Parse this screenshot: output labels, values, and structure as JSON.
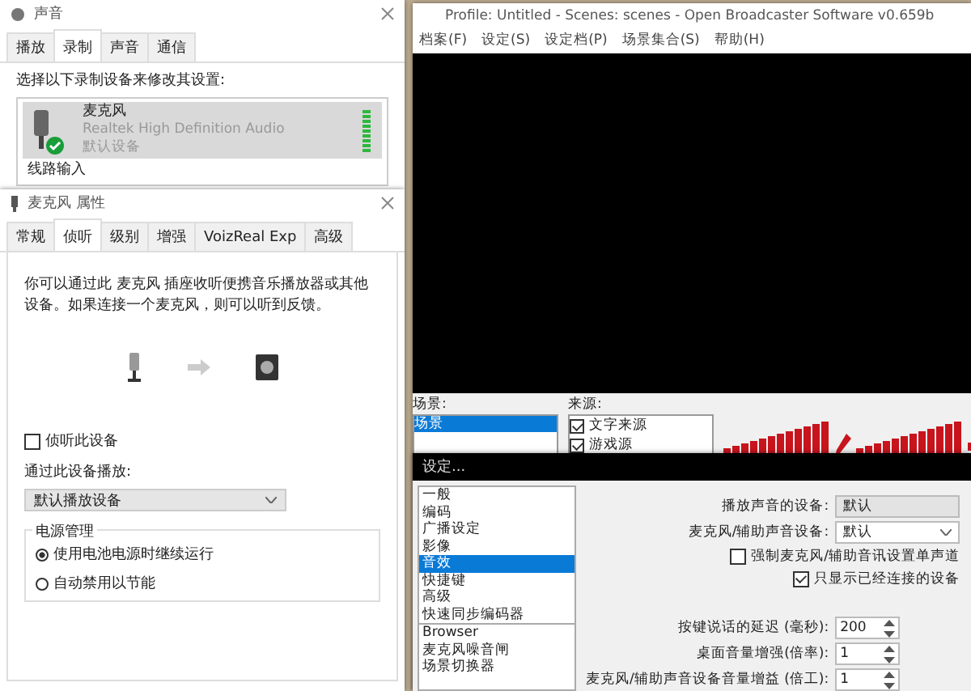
{
  "sound_window": {
    "title": "声音",
    "tabs": [
      {
        "label": "播放",
        "selected": false
      },
      {
        "label": "录制",
        "selected": true
      },
      {
        "label": "声音",
        "selected": false
      },
      {
        "label": "通信",
        "selected": false
      }
    ],
    "instruction": "选择以下录制设备来修改其设置:",
    "devices": [
      {
        "name": "麦克风",
        "driver": "Realtek High Definition Audio",
        "status": "默认设备",
        "selected": true
      },
      {
        "name": "线路输入",
        "selected": false
      }
    ]
  },
  "properties_window": {
    "title": "麦克风 属性",
    "tabs": [
      {
        "label": "常规",
        "selected": false
      },
      {
        "label": "侦听",
        "selected": true
      },
      {
        "label": "级别",
        "selected": false
      },
      {
        "label": "增强",
        "selected": false
      },
      {
        "label": "VoizReal Exp",
        "selected": false
      },
      {
        "label": "高级",
        "selected": false
      }
    ],
    "description": "你可以通过此 麦克风 插座收听便携音乐播放器或其他设备。如果连接一个麦克风，则可以听到反馈。",
    "listen_checkbox": {
      "label": "侦听此设备",
      "checked": false
    },
    "playback_label": "通过此设备播放:",
    "playback_select": {
      "value": "默认播放设备"
    },
    "power": {
      "title": "电源管理",
      "options": [
        {
          "label": "使用电池电源时继续运行",
          "selected": true
        },
        {
          "label": "自动禁用以节能",
          "selected": false
        }
      ]
    }
  },
  "obs_window": {
    "title": "Profile: Untitled - Scenes: scenes - Open Broadcaster Software v0.659b",
    "menu": [
      "档案(F)",
      "设定(S)",
      "设定档(P)",
      "场景集合(S)",
      "帮助(H)"
    ],
    "scenes": {
      "label": "场景:",
      "items": [
        {
          "label": "场景",
          "selected": true
        }
      ]
    },
    "sources": {
      "label": "来源:",
      "items": [
        {
          "label": "文字来源",
          "checked": true
        },
        {
          "label": "游戏源",
          "checked": true
        }
      ]
    }
  },
  "settings_dialog": {
    "title": "设定...",
    "category_groups": [
      {
        "items": [
          {
            "label": "一般",
            "selected": false
          },
          {
            "label": "编码",
            "selected": false
          },
          {
            "label": "广播设定",
            "selected": false
          },
          {
            "label": "影像",
            "selected": false
          },
          {
            "label": "音效",
            "selected": true
          },
          {
            "label": "快捷键",
            "selected": false
          },
          {
            "label": "高级",
            "selected": false
          },
          {
            "label": "快速同步编码器",
            "selected": false
          }
        ]
      },
      {
        "items": [
          {
            "label": "Browser",
            "selected": false
          },
          {
            "label": "麦克风噪音闸",
            "selected": false
          },
          {
            "label": "场景切换器",
            "selected": false
          }
        ]
      }
    ],
    "fields": [
      {
        "kind": "select",
        "label": "播放声音的设备:",
        "value": "默认",
        "disabled": true
      },
      {
        "kind": "select",
        "label": "麦克风/辅助声音设备:",
        "value": "默认",
        "disabled": false
      },
      {
        "kind": "checkbox",
        "label": "强制麦克风/辅助音讯设置单声道",
        "checked": false
      },
      {
        "kind": "checkbox",
        "label": "只显示已经连接的设备",
        "checked": true
      },
      {
        "kind": "spin",
        "label": "按键说话的延迟 (毫秒):",
        "value": "200"
      },
      {
        "kind": "spin",
        "label": "桌面音量增强(倍率):",
        "value": "1"
      },
      {
        "kind": "spin",
        "label": "麦克风/辅助声音设备音量增益 (倍工):",
        "value": "1"
      }
    ]
  }
}
